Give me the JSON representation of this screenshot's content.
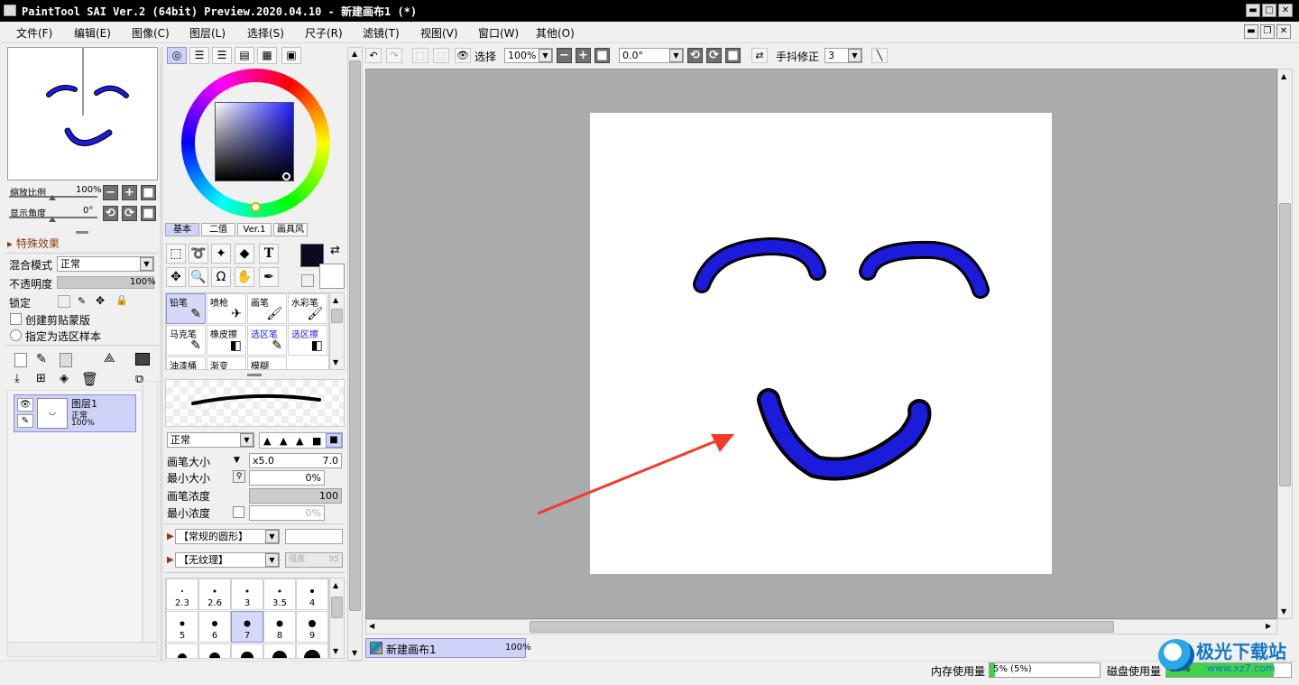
{
  "window": {
    "title": "PaintTool SAI Ver.2 (64bit) Preview.2020.04.10 - 新建画布1 (*)",
    "min": "▬",
    "max": "□",
    "close": "✕"
  },
  "menu": [
    "文件(F)",
    "编辑(E)",
    "图像(C)",
    "图层(L)",
    "选择(S)",
    "尺子(R)",
    "滤镜(T)",
    "视图(V)",
    "窗口(W)",
    "其他(O)"
  ],
  "nav": {
    "zoom_label": "缩放比例",
    "zoom_value": "100%",
    "angle_label": "显示角度",
    "angle_value": "0°"
  },
  "layer_panel": {
    "effects_label": "特殊效果",
    "blend_label": "混合模式",
    "blend_value": "正常",
    "opacity_label": "不透明度",
    "opacity_value": "100%",
    "lock_label": "锁定",
    "clip_label": "创建剪贴蒙版",
    "sample_label": "指定为选区样本",
    "layer": {
      "name": "图层1",
      "mode": "正常",
      "opacity": "100%"
    }
  },
  "color_tabs": [
    "基本",
    "二值",
    "Ver.1",
    "画具风"
  ],
  "brushes": [
    {
      "name": "铅笔",
      "icon": "✎",
      "selected": true
    },
    {
      "name": "喷枪",
      "icon": "✈"
    },
    {
      "name": "画笔",
      "icon": "🖌"
    },
    {
      "name": "水彩笔",
      "icon": "🖌"
    },
    {
      "name": "马克笔",
      "icon": "✎"
    },
    {
      "name": "橡皮擦",
      "icon": "◧"
    },
    {
      "name": "选区笔",
      "icon": "✎",
      "blue": true
    },
    {
      "name": "选区擦",
      "icon": "◧",
      "blue": true
    },
    {
      "name": "油漆桶",
      "icon": ""
    },
    {
      "name": "渐变",
      "icon": ""
    },
    {
      "name": "模糊",
      "icon": ""
    }
  ],
  "brush_settings": {
    "mode": "正常",
    "size_label": "画笔大小",
    "size_mult": "x5.0",
    "size_value": "7.0",
    "min_size_label": "最小大小",
    "min_size_value": "0%",
    "density_label": "画笔浓度",
    "density_value": "100",
    "min_density_label": "最小浓度",
    "min_density_value": "0%",
    "shape": "【常规的圆形】",
    "texture": "【无纹理】",
    "texture_strength_label": "强度",
    "texture_strength_value": "95"
  },
  "size_grid": [
    {
      "v": "2.3",
      "d": 2
    },
    {
      "v": "2.6",
      "d": 3
    },
    {
      "v": "3",
      "d": 3
    },
    {
      "v": "3.5",
      "d": 3
    },
    {
      "v": "4",
      "d": 4
    },
    {
      "v": "5",
      "d": 5
    },
    {
      "v": "6",
      "d": 6
    },
    {
      "v": "7",
      "d": 7,
      "sel": true
    },
    {
      "v": "8",
      "d": 7
    },
    {
      "v": "9",
      "d": 8
    },
    {
      "v": "",
      "d": 10
    },
    {
      "v": "",
      "d": 12
    },
    {
      "v": "",
      "d": 14
    },
    {
      "v": "",
      "d": 16
    },
    {
      "v": "",
      "d": 18
    }
  ],
  "toolbar": {
    "select_label": "选择",
    "zoom": "100%",
    "angle": "0.0°",
    "stabilizer_label": "手抖修正",
    "stabilizer_value": "3"
  },
  "doc_tab": {
    "name": "新建画布1",
    "zoom": "100%"
  },
  "status": {
    "mem_label": "内存使用量",
    "mem_value": "5% (5%)",
    "disk_label": "磁盘使用量",
    "disk_value": "86%"
  },
  "watermark": {
    "text": "极光下载站",
    "url": "www.xz7.com"
  },
  "colors": {
    "stroke_blue": "#1b1bdb",
    "accent": "#cfd2f7",
    "canvas_bg": "#ababab",
    "arrow": "#f23a2a"
  }
}
